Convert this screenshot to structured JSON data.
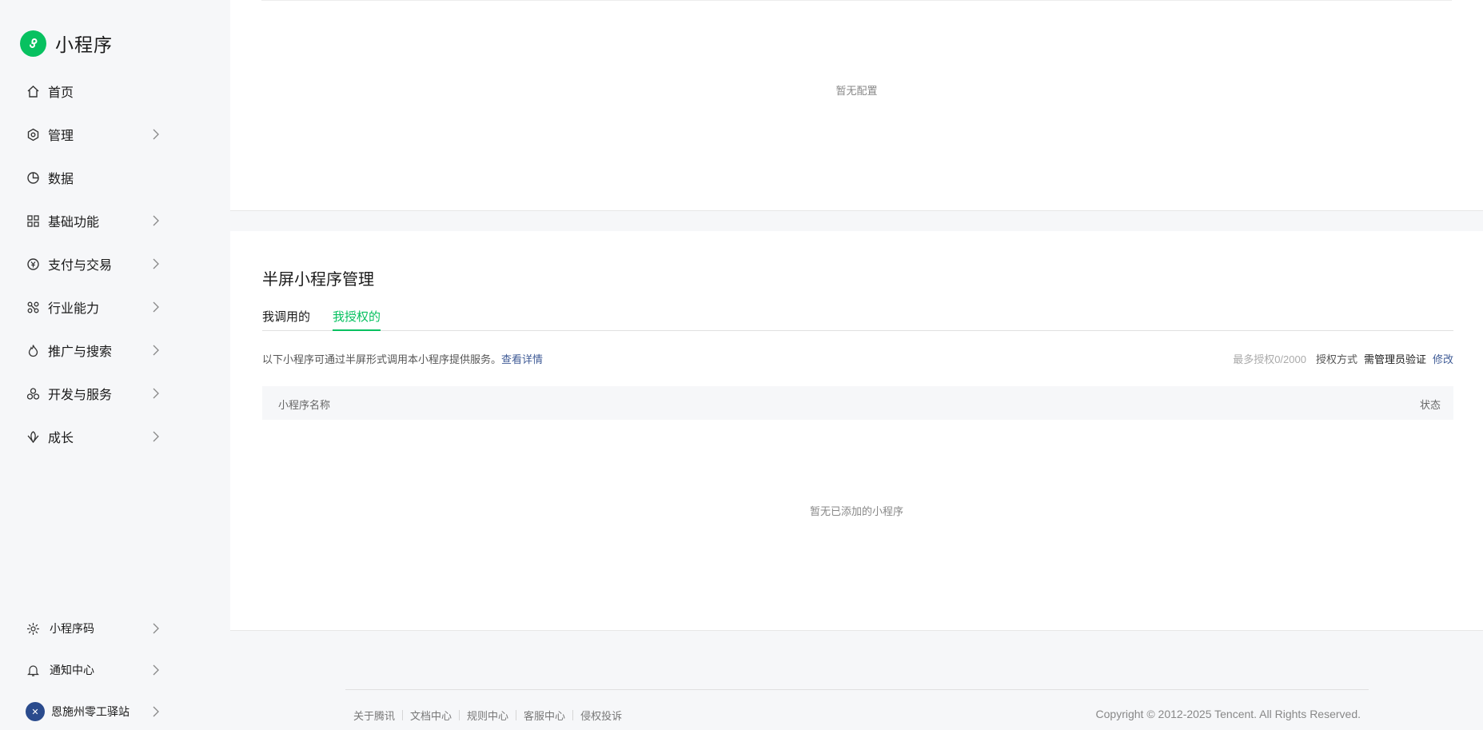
{
  "app": {
    "title": "小程序"
  },
  "sidebar": {
    "items": [
      {
        "label": "首页",
        "icon": "home-icon",
        "has_chevron": false
      },
      {
        "label": "管理",
        "icon": "settings-hexagon-icon",
        "has_chevron": true
      },
      {
        "label": "数据",
        "icon": "pie-chart-icon",
        "has_chevron": false
      },
      {
        "label": "基础功能",
        "icon": "grid-icon",
        "has_chevron": true
      },
      {
        "label": "支付与交易",
        "icon": "yen-icon",
        "has_chevron": true
      },
      {
        "label": "行业能力",
        "icon": "industry-icon",
        "has_chevron": true
      },
      {
        "label": "推广与搜索",
        "icon": "flame-icon",
        "has_chevron": true
      },
      {
        "label": "开发与服务",
        "icon": "dev-icon",
        "has_chevron": true
      },
      {
        "label": "成长",
        "icon": "growth-icon",
        "has_chevron": true
      }
    ],
    "bottom": [
      {
        "label": "小程序码",
        "icon": "qrcode-sun-icon"
      },
      {
        "label": "通知中心",
        "icon": "bell-icon"
      },
      {
        "label": "恩施州零工驿站",
        "icon": "avatar"
      }
    ]
  },
  "top_card": {
    "empty_text": "暂无配置"
  },
  "section": {
    "title": "半屏小程序管理",
    "tabs": [
      {
        "label": "我调用的",
        "active": false
      },
      {
        "label": "我授权的",
        "active": true
      }
    ],
    "description": "以下小程序可通过半屏形式调用本小程序提供服务。",
    "detail_link": "查看详情",
    "max_auth": "最多授权0/2000",
    "auth_method_label": "授权方式",
    "auth_method_value": "需管理员验证",
    "modify_link": "修改",
    "table": {
      "columns": [
        "小程序名称",
        "状态"
      ]
    },
    "empty_text": "暂无已添加的小程序"
  },
  "footer": {
    "links": [
      "关于腾讯",
      "文档中心",
      "规则中心",
      "客服中心",
      "侵权投诉"
    ],
    "copyright": "Copyright © 2012-2025 Tencent. All Rights Reserved."
  },
  "colors": {
    "accent": "#07c160",
    "link": "#3f5b96"
  }
}
